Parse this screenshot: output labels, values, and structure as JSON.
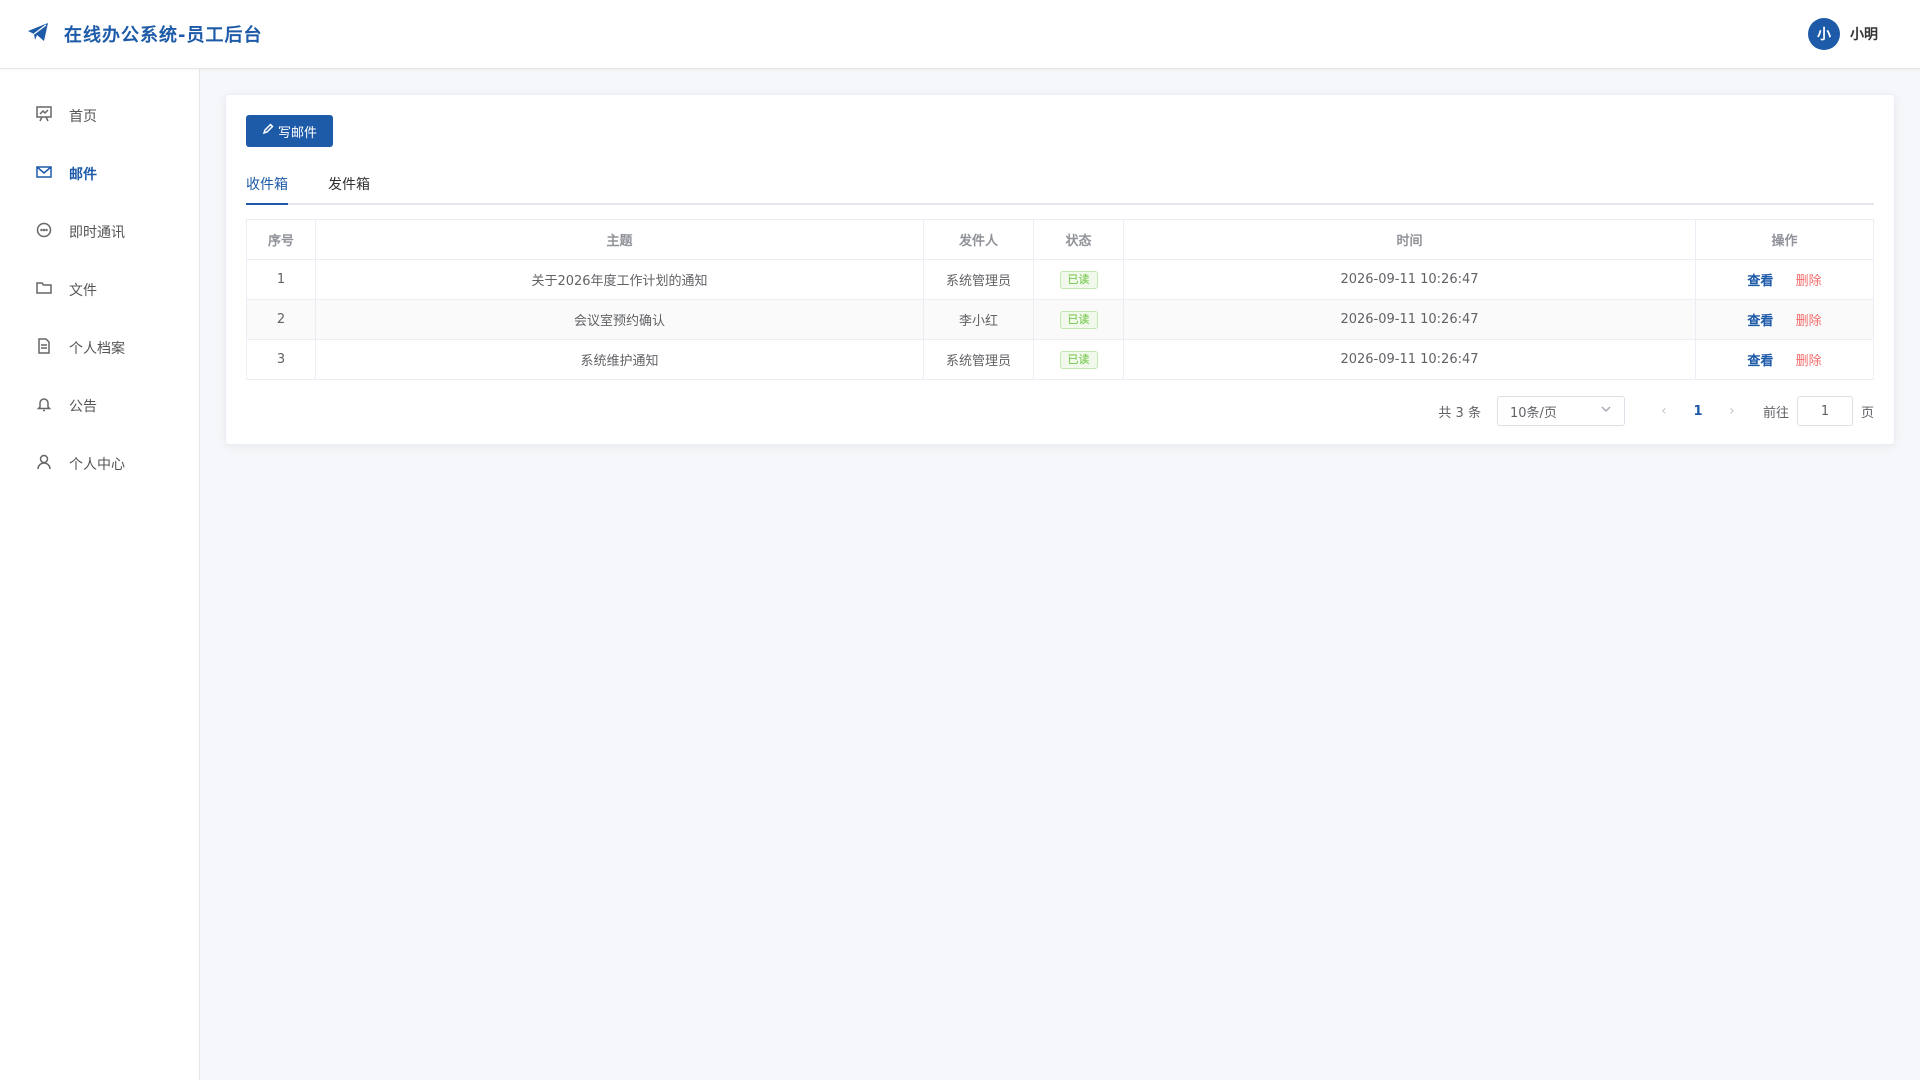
{
  "header": {
    "title": "在线办公系统-员工后台",
    "logo_icon": "paper-plane-icon",
    "user": {
      "avatar_text": "小",
      "name": "小明"
    }
  },
  "sidebar": {
    "items": [
      {
        "label": "首页",
        "icon": "chart-board-icon"
      },
      {
        "label": "邮件",
        "icon": "mail-icon",
        "active": true
      },
      {
        "label": "即时通讯",
        "icon": "chat-icon"
      },
      {
        "label": "文件",
        "icon": "folder-icon"
      },
      {
        "label": "个人档案",
        "icon": "document-icon"
      },
      {
        "label": "公告",
        "icon": "bell-icon"
      },
      {
        "label": "个人中心",
        "icon": "user-icon"
      }
    ]
  },
  "main": {
    "compose_label": "写邮件",
    "tabs": [
      {
        "label": "收件箱",
        "active": true
      },
      {
        "label": "发件箱"
      }
    ],
    "table": {
      "columns": [
        "序号",
        "主题",
        "发件人",
        "状态",
        "时间",
        "操作"
      ],
      "rows": [
        {
          "index": "1",
          "subject": "关于2026年度工作计划的通知",
          "sender": "系统管理员",
          "status": "已读",
          "time": "2026-09-11 10:26:47"
        },
        {
          "index": "2",
          "subject": "会议室预约确认",
          "sender": "李小红",
          "status": "已读",
          "time": "2026-09-11 10:26:47"
        },
        {
          "index": "3",
          "subject": "系统维护通知",
          "sender": "系统管理员",
          "status": "已读",
          "time": "2026-09-11 10:26:47"
        }
      ],
      "actions": {
        "view": "查看",
        "delete": "删除"
      }
    },
    "pagination": {
      "total": "共 3 条",
      "page_size": "10条/页",
      "current_page": "1",
      "goto_label": "前往",
      "goto_value": "1",
      "page_unit": "页"
    }
  },
  "colors": {
    "primary": "#1d5aa8",
    "danger": "#f56c6c",
    "success": "#67c23a"
  }
}
